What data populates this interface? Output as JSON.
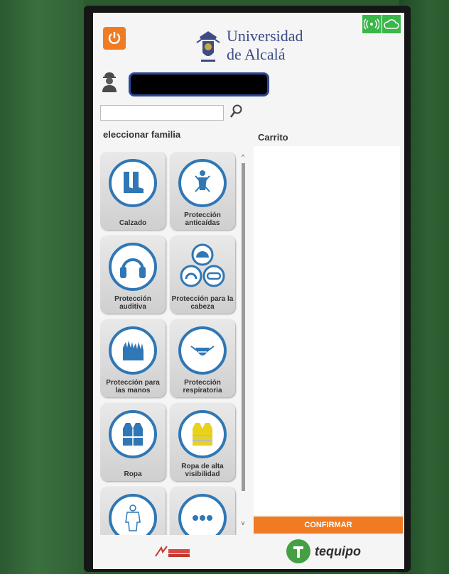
{
  "header": {
    "university_name_line1": "Universidad",
    "university_name_line2": "de Alcalá"
  },
  "search": {
    "placeholder": ""
  },
  "families": {
    "title": "eleccionar familia",
    "items": [
      {
        "label": "Calzado",
        "icon": "boots-icon"
      },
      {
        "label": "Protección anticaídas",
        "icon": "harness-icon"
      },
      {
        "label": "Protección auditiva",
        "icon": "ear-muffs-icon"
      },
      {
        "label": "Protección para la cabeza",
        "icon": "head-protection-icon"
      },
      {
        "label": "Protección para las manos",
        "icon": "gloves-icon"
      },
      {
        "label": "Protección respiratoria",
        "icon": "mask-icon"
      },
      {
        "label": "Ropa",
        "icon": "vest-icon"
      },
      {
        "label": "Ropa de alta visibilidad",
        "icon": "hi-vis-vest-icon"
      },
      {
        "label": "",
        "icon": "coverall-icon"
      },
      {
        "label": "",
        "icon": "more-icon"
      }
    ]
  },
  "cart": {
    "title": "Carrito"
  },
  "confirm": {
    "label": "CONFIRMAR"
  },
  "footer": {
    "brand_right": "tequipo"
  },
  "colors": {
    "accent": "#f07b22",
    "blue": "#2f77b5",
    "status_green": "#3bb64b",
    "brand_green": "#45a043"
  }
}
